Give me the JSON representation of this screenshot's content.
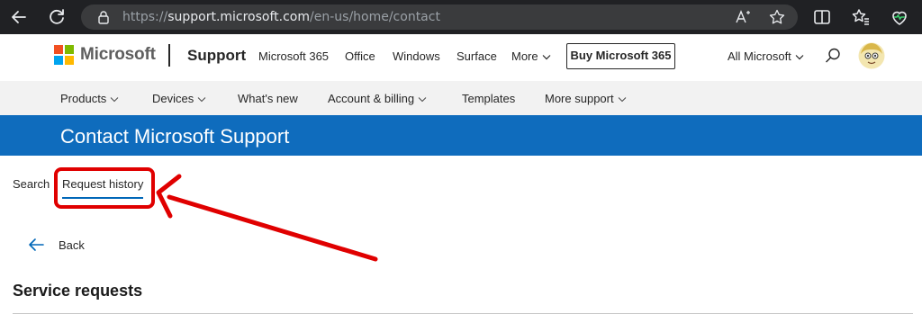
{
  "browser": {
    "url_prefix": "https://",
    "url_host": "support.microsoft.com",
    "url_path": "/en-us/home/contact"
  },
  "header": {
    "brand": "Microsoft",
    "section": "Support",
    "nav": [
      "Microsoft 365",
      "Office",
      "Windows",
      "Surface",
      "More"
    ],
    "buy_button": "Buy Microsoft 365",
    "all_microsoft": "All Microsoft",
    "logo_colors": [
      "#f25022",
      "#7fba00",
      "#00a4ef",
      "#ffb900"
    ]
  },
  "subnav": {
    "items": [
      "Products",
      "Devices",
      "What's new",
      "Account & billing",
      "Templates",
      "More support"
    ]
  },
  "banner": {
    "title": "Contact Microsoft Support",
    "color": "#0f6cbd"
  },
  "tabs": {
    "search": "Search",
    "request_history": "Request history"
  },
  "back": {
    "label": "Back"
  },
  "main": {
    "section_title": "Service requests"
  },
  "annotation": {
    "color": "#e00000"
  }
}
